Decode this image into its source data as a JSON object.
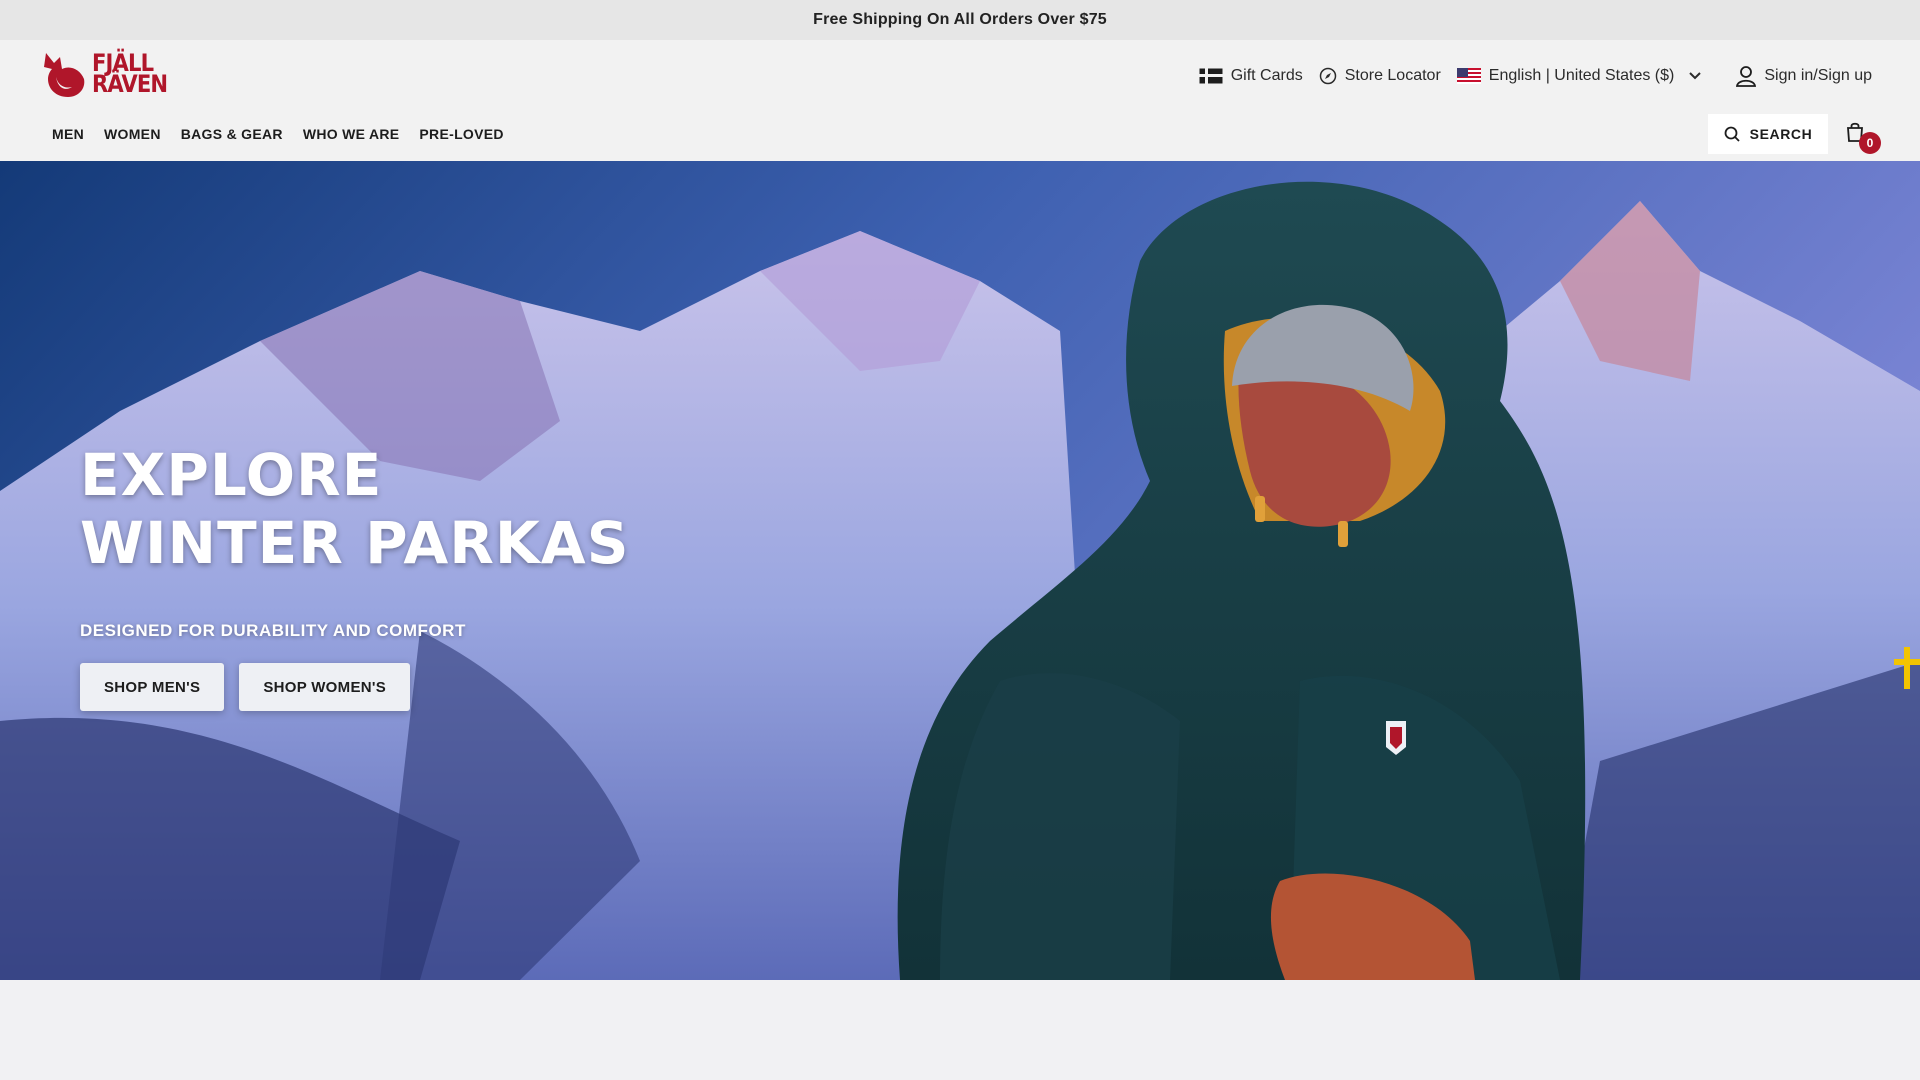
{
  "announcement": {
    "text": "Free Shipping On All Orders Over $75"
  },
  "logo": {
    "line1": "FJÄLL",
    "line2": "RÄVEN"
  },
  "utility_nav": {
    "gift_cards": "Gift Cards",
    "store_locator": "Store Locator",
    "locale": "English | United States ($)",
    "sign_in": "Sign in/Sign up"
  },
  "main_nav": [
    {
      "label": "MEN"
    },
    {
      "label": "WOMEN"
    },
    {
      "label": "BAGS & GEAR"
    },
    {
      "label": "WHO WE ARE"
    },
    {
      "label": "PRE-LOVED"
    }
  ],
  "search": {
    "label": "SEARCH"
  },
  "cart": {
    "count": "0"
  },
  "hero": {
    "title": "EXPLORE\nWINTER PARKAS",
    "subtitle": "DESIGNED FOR DURABILITY AND COMFORT",
    "buttons": [
      {
        "label": "SHOP MEN'S"
      },
      {
        "label": "SHOP WOMEN'S"
      }
    ]
  },
  "colors": {
    "brand_red": "#b0162a",
    "swedish_yellow": "#f2c400",
    "swedish_blue": "#1f5fa8"
  },
  "icons": {
    "gift_cards": "gift-card-icon",
    "store_locator": "compass-icon",
    "locale_flag": "us-flag-icon",
    "locale_chevron": "chevron-down-icon",
    "account": "user-icon",
    "search": "search-icon",
    "cart": "shopping-bag-icon",
    "side_tab": "swedish-flag-icon"
  }
}
